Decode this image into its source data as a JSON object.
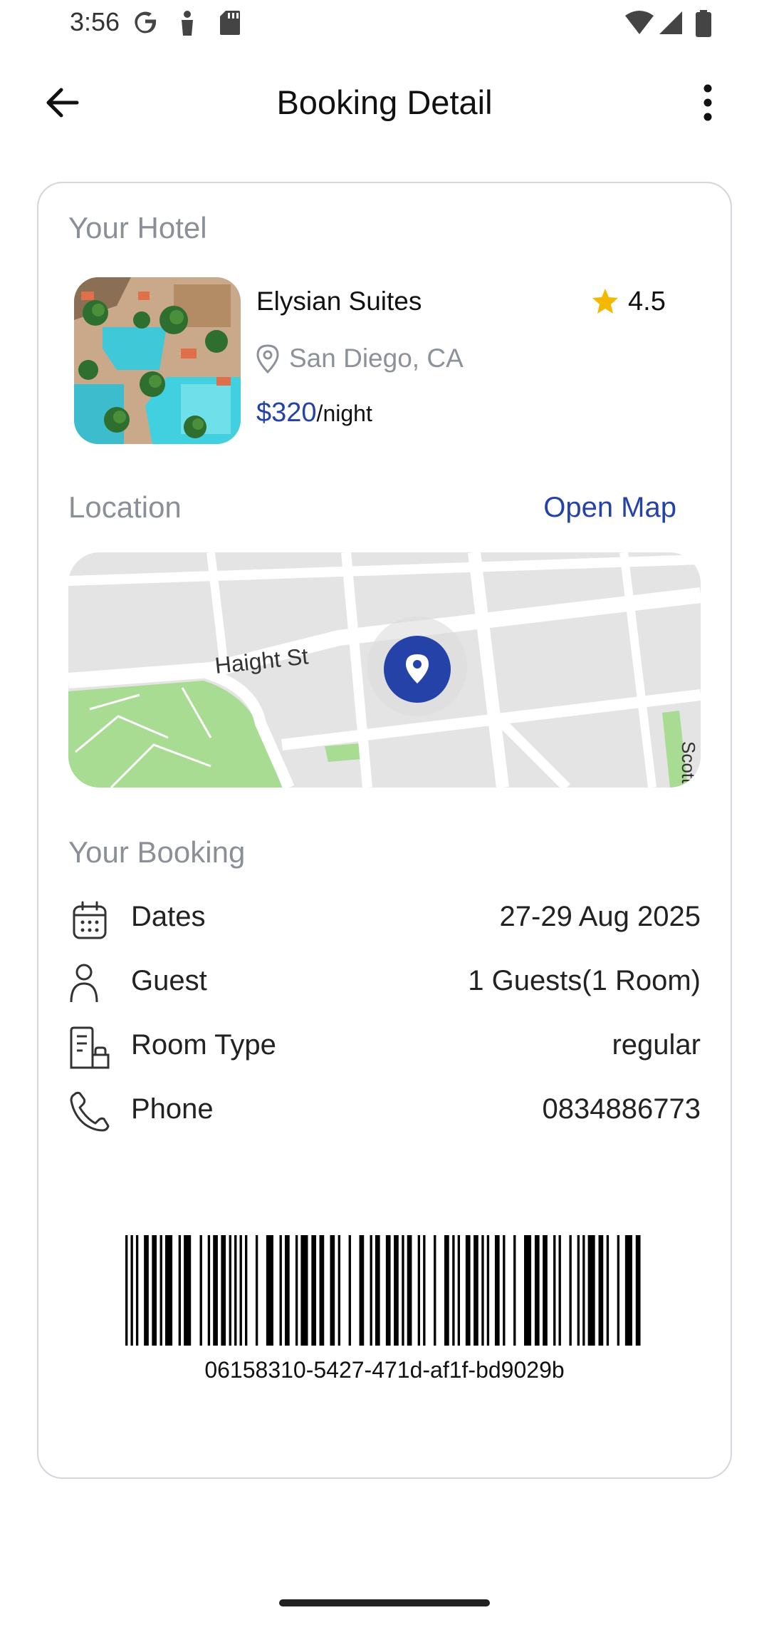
{
  "status_bar": {
    "time": "3:56",
    "left_icons": [
      "google-icon",
      "person-icon",
      "sd-card-icon"
    ],
    "right_icons": [
      "wifi-icon",
      "signal-icon",
      "battery-icon"
    ]
  },
  "app_bar": {
    "title": "Booking Detail",
    "back_icon": "arrow-left-icon",
    "more_icon": "more-vertical-icon"
  },
  "hotel": {
    "section_label": "Your Hotel",
    "name": "Elysian Suites",
    "rating": "4.5",
    "location": "San Diego, CA",
    "price": "$320",
    "price_unit": "/night"
  },
  "location": {
    "section_label": "Location",
    "open_map_label": "Open Map",
    "map_street_label": "Haight St",
    "map_edge_label": "Scott"
  },
  "booking": {
    "section_label": "Your Booking",
    "rows": [
      {
        "icon": "calendar-icon",
        "label": "Dates",
        "value": "27-29 Aug 2025"
      },
      {
        "icon": "user-icon",
        "label": "Guest",
        "value": "1 Guests(1 Room)"
      },
      {
        "icon": "room-icon",
        "label": "Room Type",
        "value": "regular"
      },
      {
        "icon": "phone-icon",
        "label": "Phone",
        "value": "0834886773"
      }
    ]
  },
  "barcode": {
    "code": "06158310-5427-471d-af1f-bd9029b"
  },
  "colors": {
    "accent": "#2442a8",
    "star": "#f5b800",
    "muted_text": "#8a8f98",
    "card_border": "#d3d6dc",
    "map_park": "#a8dc92"
  }
}
